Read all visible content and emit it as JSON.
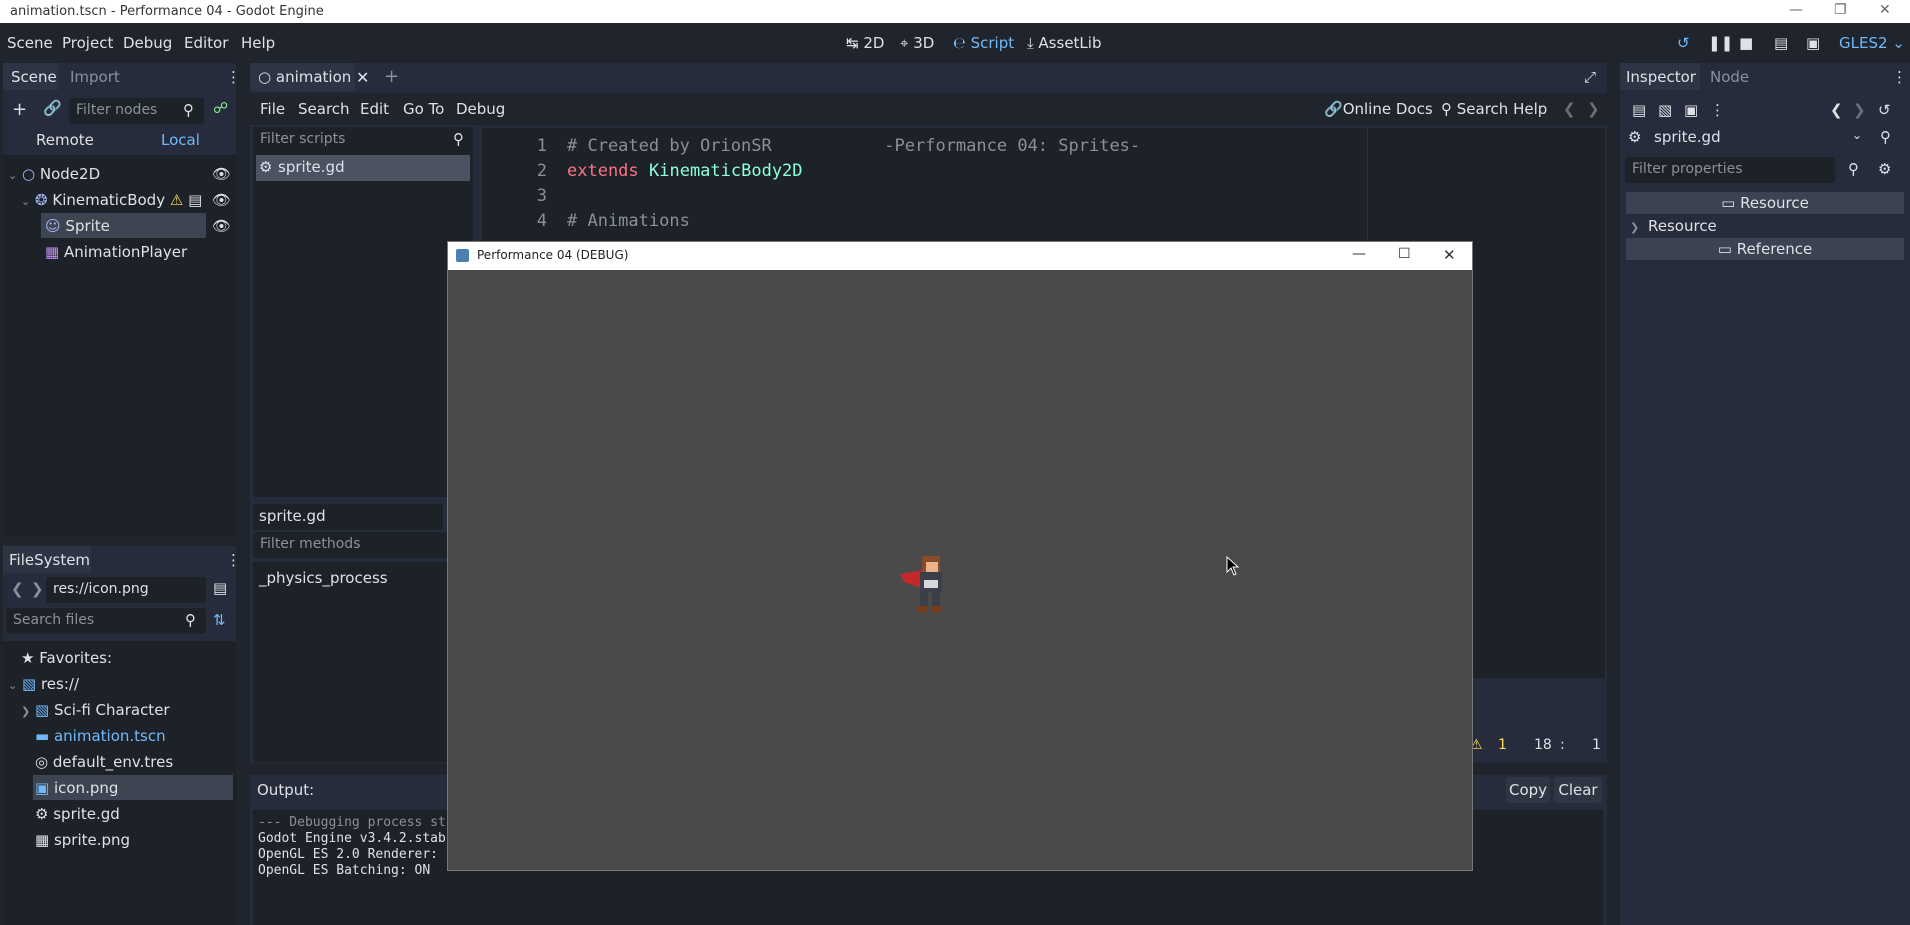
{
  "window": {
    "title": "animation.tscn - Performance 04 - Godot Engine"
  },
  "menu": {
    "scene": "Scene",
    "project": "Project",
    "debug": "Debug",
    "editor": "Editor",
    "help": "Help"
  },
  "workspaces": {
    "d2": "2D",
    "d3": "3D",
    "script": "Script",
    "assetlib": "AssetLib"
  },
  "renderer": "GLES2",
  "scene_dock": {
    "tab_scene": "Scene",
    "tab_import": "Import",
    "filter_placeholder": "Filter nodes",
    "remote": "Remote",
    "local": "Local",
    "nodes": [
      "Node2D",
      "KinematicBody",
      "Sprite",
      "AnimationPlayer"
    ]
  },
  "filesystem": {
    "tab": "FileSystem",
    "path": "res://icon.png",
    "search_placeholder": "Search files",
    "favorites": "Favorites:",
    "items": [
      "res://",
      "Sci-fi Character",
      "animation.tscn",
      "default_env.tres",
      "icon.png",
      "sprite.gd",
      "sprite.png"
    ]
  },
  "editor": {
    "tab": "animation",
    "menu": {
      "file": "File",
      "search": "Search",
      "edit": "Edit",
      "goto": "Go To",
      "debug": "Debug"
    },
    "online_docs": "Online Docs",
    "search_help": "Search Help",
    "filter_scripts": "Filter scripts",
    "scripts": [
      "sprite.gd"
    ],
    "current_script": "sprite.gd",
    "filter_methods": "Filter methods",
    "methods": [
      "_physics_process"
    ],
    "code": [
      {
        "n": "1",
        "text": "# Created by OrionSR           -Performance 04: Sprites-"
      },
      {
        "n": "2",
        "kw": "extends",
        "cls": "KinematicBody2D"
      },
      {
        "n": "3",
        "text": ""
      },
      {
        "n": "4",
        "text": "# Animations"
      }
    ],
    "status": {
      "warnings": "1",
      "line": "18",
      "sep": ":",
      "col": "1"
    }
  },
  "output": {
    "label": "Output:",
    "copy": "Copy",
    "clear": "Clear",
    "lines": [
      "--- Debugging process st",
      "Godot Engine v3.4.2.stab",
      "OpenGL ES 2.0 Renderer:",
      "OpenGL ES Batching: ON"
    ]
  },
  "inspector": {
    "tab_inspector": "Inspector",
    "tab_node": "Node",
    "object": "sprite.gd",
    "filter_placeholder": "Filter properties",
    "resource_header": "Resource",
    "resource_section": "Resource",
    "reference_header": "Reference"
  },
  "game_window": {
    "title": "Performance 04 (DEBUG)"
  },
  "colors": {
    "accent": "#70bafa",
    "bg": "#20242d",
    "panel": "#262c3b",
    "game": "#4a4a4a"
  }
}
